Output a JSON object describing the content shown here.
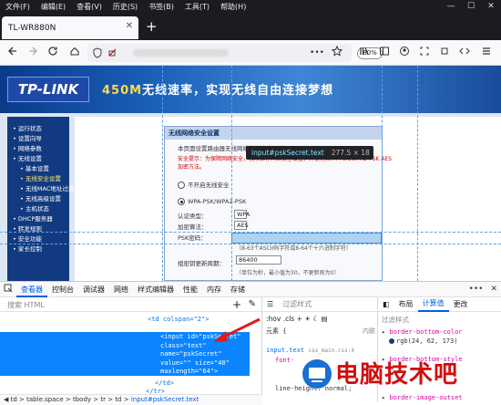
{
  "menubar": {
    "items": [
      "文件(F)",
      "编辑(E)",
      "查看(V)",
      "历史(S)",
      "书签(B)",
      "工具(T)",
      "帮助(H)"
    ],
    "window_controls": [
      "—",
      "☐",
      "✕"
    ]
  },
  "tab": {
    "title": "TL-WR880N",
    "close": "✕",
    "new_tab": "+"
  },
  "navbar": {
    "zoom": "80%",
    "more": "•••"
  },
  "page": {
    "logo": "TP-LINK",
    "slogan_accent": "450M",
    "slogan": "无线速率，实现无线自由连接梦想",
    "sidebar": [
      {
        "label": "• 运行状态",
        "sub": false,
        "sel": false
      },
      {
        "label": "• 设置向导",
        "sub": false,
        "sel": false
      },
      {
        "label": "• 网络参数",
        "sub": false,
        "sel": false
      },
      {
        "label": "• 无线设置",
        "sub": false,
        "sel": false
      },
      {
        "label": "• 基本设置",
        "sub": true,
        "sel": false
      },
      {
        "label": "• 无线安全设置",
        "sub": true,
        "sel": true
      },
      {
        "label": "• 无线MAC地址过滤",
        "sub": true,
        "sel": false
      },
      {
        "label": "• 无线高级设置",
        "sub": true,
        "sel": false
      },
      {
        "label": "• 主机状态",
        "sub": true,
        "sel": false
      },
      {
        "label": "• DHCP服务器",
        "sub": false,
        "sel": false
      },
      {
        "label": "• 转发规则",
        "sub": false,
        "sel": false
      },
      {
        "label": "• 安全功能",
        "sub": false,
        "sel": false
      },
      {
        "label": "• 家长控制",
        "sub": false,
        "sel": false
      }
    ],
    "panel_title": "无线网络安全设置",
    "intro": "本页面设置路由器无线网络的安全认证选项。",
    "warn1": "安全提示：为保障网络安全，强烈推荐开启安全设置，并使用WPA-PSK/WPA2-PSK AES",
    "warn2": "加密方法。",
    "opt_none": "不开启无线安全",
    "opt_wpa": "WPA-PSK/WPA2-PSK",
    "auth_label": "认证类型：",
    "auth_value": "WPA",
    "enc_label": "加密算法：",
    "enc_value": "AES",
    "pwd_label": "PSK密码：",
    "pwd_hint": "（8-63个ASCII码字符或8-64个十六进制字符）",
    "period_label": "组密钥更新周期：",
    "period_value": "86400",
    "period_hint": "（单位为秒，最小值为30，不更新则为0）"
  },
  "tooltip": {
    "id": "input#pskSecret.text",
    "size": "277.5 × 18"
  },
  "devtools": {
    "tabs": [
      "查看器",
      "控制台",
      "调试器",
      "网络",
      "样式编辑器",
      "性能",
      "内存",
      "存储"
    ],
    "search_placeholder": "搜索 HTML",
    "code": {
      "td_open": "<td colspan=\"2\">",
      "input_l1": "<input id=\"pskSecret\"",
      "input_l2": "class=\"text\"",
      "input_l3": "name=\"pskSecret\"",
      "input_l4": "value=\"\" size=\"40\"",
      "input_l5": "maxlength=\"64\">",
      "td_close": "</td>",
      "tr_close": "</tr>"
    },
    "breadcrumb": [
      "td",
      "table.space",
      "tbody",
      "tr",
      "td"
    ],
    "breadcrumb_last": "input#pskSecret.text",
    "rules_filter": "过滤样式",
    "rules_toggles": [
      ":hov",
      ".cls"
    ],
    "element_label": "元素 {",
    "inline": "内联",
    "selector": "input.text",
    "selector_src": "css_main.css:4",
    "prop1": "font-",
    "prop2": "line-height: normal;",
    "layout_tabs": [
      "布局",
      "计算值",
      "更改"
    ],
    "computed_filter": "过滤样式",
    "computed": [
      {
        "name": "border-bottom-color",
        "value": "rgb(24, 62, 173)"
      },
      {
        "name": "border-bottom-style",
        "value": ""
      },
      {
        "name": "border-image-outset",
        "value": ""
      }
    ]
  },
  "watermark": "电脑技术吧"
}
